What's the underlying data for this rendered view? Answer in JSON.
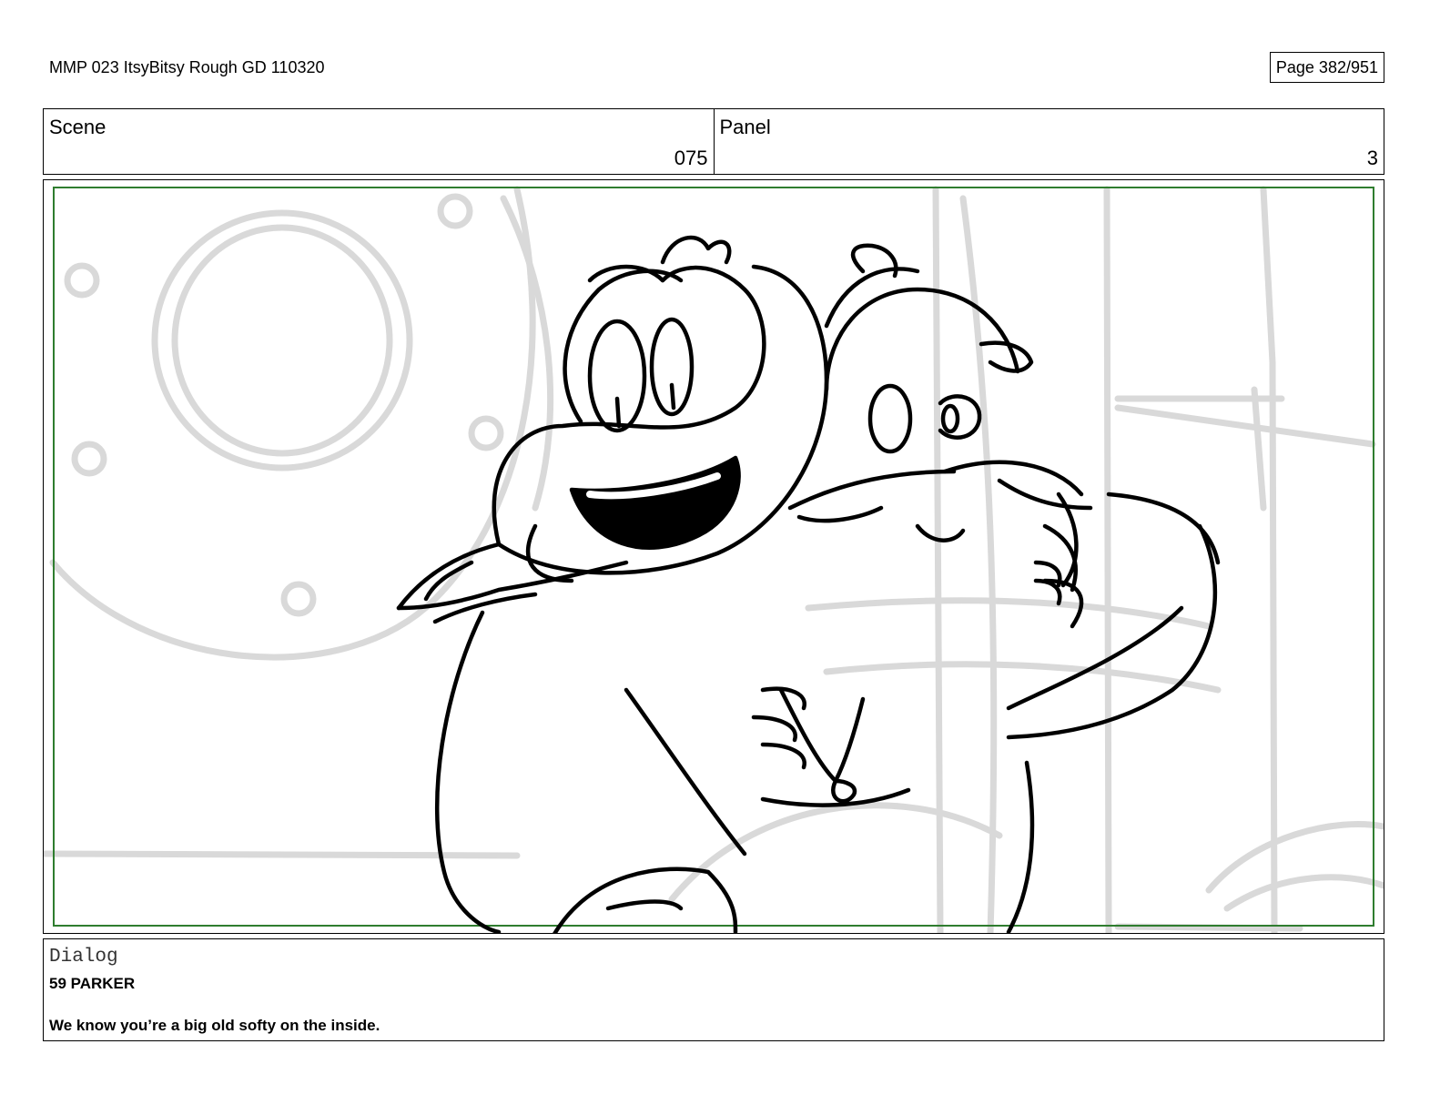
{
  "header": {
    "document_title": "MMP 023 ItsyBitsy Rough GD 110320",
    "page_label": "Page 382/951"
  },
  "info": {
    "scene_label": "Scene",
    "scene_value": "075",
    "panel_label": "Panel",
    "panel_value": "3"
  },
  "dialog": {
    "label": "Dialog",
    "speaker": "59 PARKER",
    "line": "We know you’re a big old softy on the inside."
  },
  "colors": {
    "safe_frame": "#2f7d2f",
    "sketch_line": "#000000",
    "background_sketch": "#d9d9d9"
  }
}
